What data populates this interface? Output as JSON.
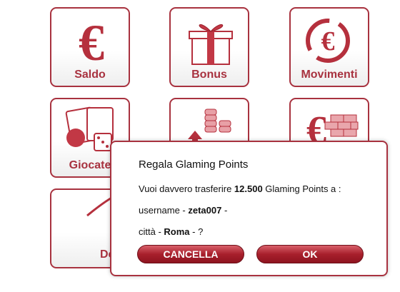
{
  "colors": {
    "accent": "#a8323f",
    "button": "#a8202c"
  },
  "tiles": [
    {
      "label": "Saldo",
      "icon": "euro-icon"
    },
    {
      "label": "Bonus",
      "icon": "gift-icon"
    },
    {
      "label": "Movimenti",
      "icon": "euro-cycle-icon"
    },
    {
      "label": "Giocate",
      "icon": "casino-icon"
    },
    {
      "label": "",
      "icon": "coins-arrow-icon"
    },
    {
      "label": "",
      "icon": "euro-wall-icon"
    },
    {
      "label": "De",
      "icon": "swoosh-icon"
    }
  ],
  "dialog": {
    "title": "Regala Glaming Points",
    "transfer_prefix": "Vuoi davvero trasferire ",
    "points": "12.500",
    "transfer_suffix": " Glaming Points a :",
    "username_label": "username - ",
    "username": "zeta007",
    "username_suffix": " -",
    "city_label": "città - ",
    "city": "Roma",
    "city_suffix": " - ?",
    "cancel_label": "CANCELLA",
    "ok_label": "OK"
  }
}
